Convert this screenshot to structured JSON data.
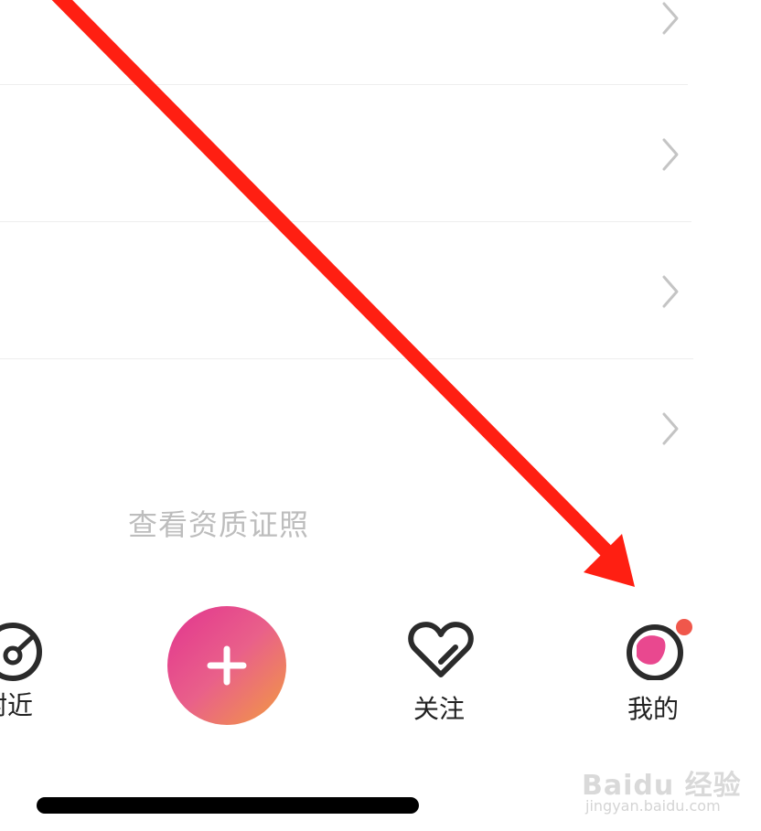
{
  "list": {
    "rows": [
      "",
      "",
      "",
      ""
    ]
  },
  "footer": {
    "qualification_link": "查看资质证照"
  },
  "tabbar": {
    "tabs": [
      {
        "icon": "compass-icon",
        "label": "附近"
      },
      {
        "icon": "plus-icon",
        "label": ""
      },
      {
        "icon": "heart-icon",
        "label": "关注"
      },
      {
        "icon": "profile-icon",
        "label": "我的"
      }
    ],
    "accent_gradient": [
      "#e2348f",
      "#f29b3f"
    ],
    "badge_color": "#f0574b"
  },
  "annotation": {
    "arrow_color": "#ff1f12"
  },
  "watermark": {
    "brand": "Baidu 经验",
    "url": "jingyan.baidu.com"
  }
}
